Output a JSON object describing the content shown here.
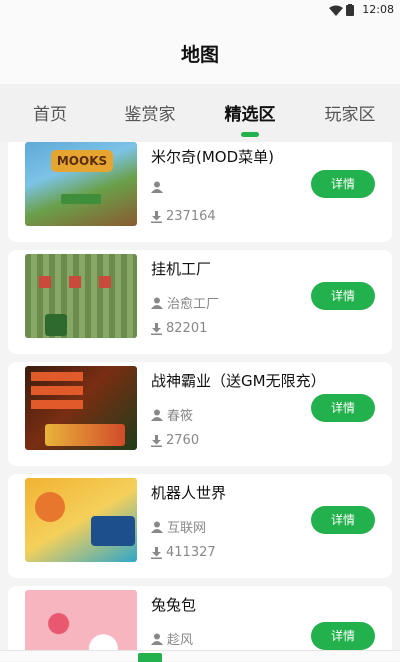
{
  "status": {
    "time": "12:08"
  },
  "header": {
    "title": "地图"
  },
  "tabs": [
    {
      "label": "首页",
      "active": false
    },
    {
      "label": "鉴赏家",
      "active": false
    },
    {
      "label": "精选区",
      "active": true
    },
    {
      "label": "玩家区",
      "active": false
    }
  ],
  "games": [
    {
      "name": "米尔奇(MOD菜单)",
      "author": "",
      "downloads": "237164",
      "button": "详情"
    },
    {
      "name": "挂机工厂",
      "author": "治愈工厂",
      "downloads": "82201",
      "button": "详情"
    },
    {
      "name": "战神霸业（送GM无限充）",
      "author": "春筱",
      "downloads": "2760",
      "button": "详情"
    },
    {
      "name": "机器人世界",
      "author": "互联网",
      "downloads": "411327",
      "button": "详情"
    },
    {
      "name": "兔兔包",
      "author": "趁风",
      "downloads": "",
      "button": "详情"
    }
  ],
  "colors": {
    "accent": "#22b14c"
  }
}
